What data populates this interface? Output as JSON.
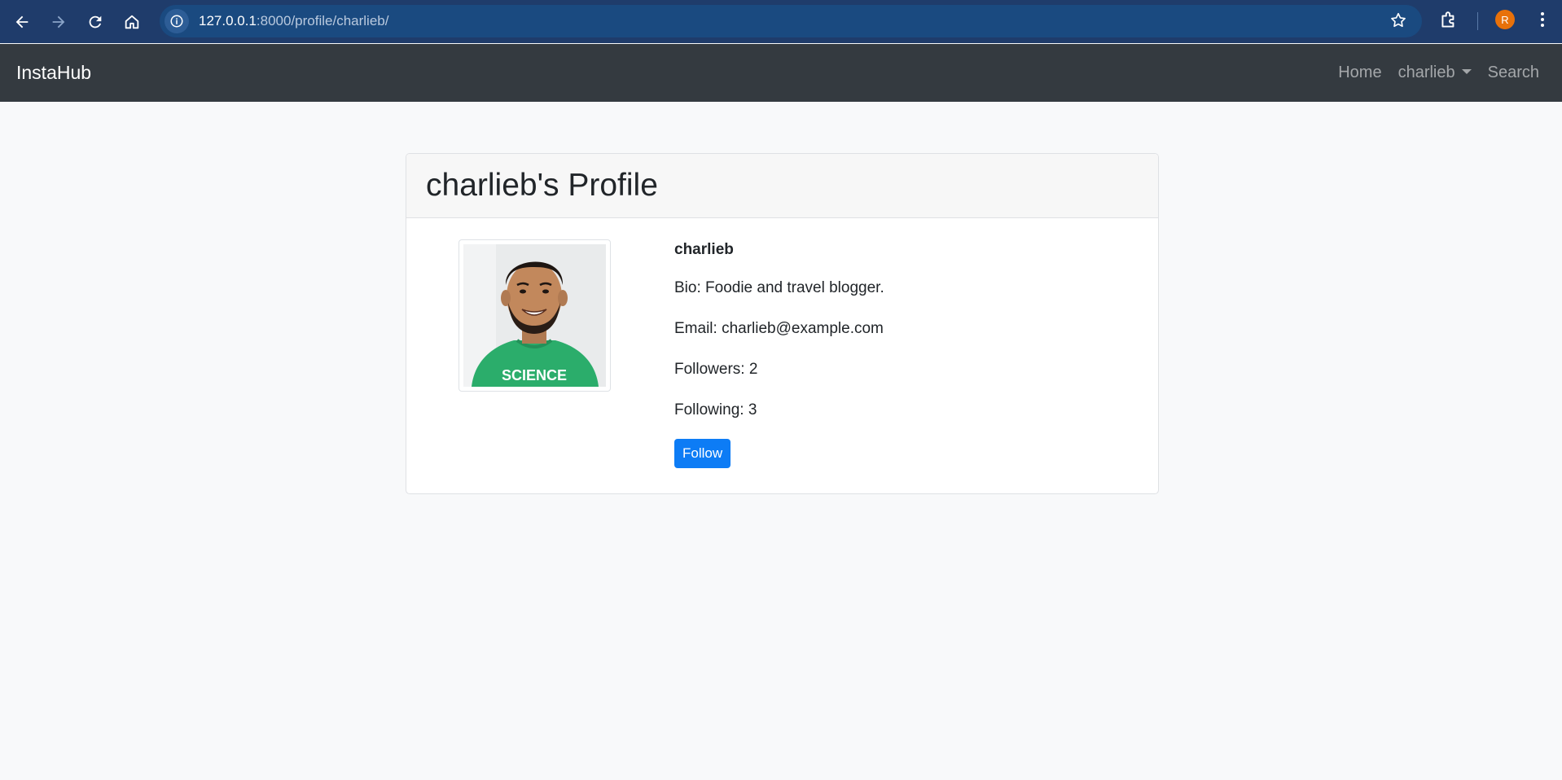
{
  "browser": {
    "url_host": "127.0.0.1",
    "url_path": ":8000/profile/charlieb/",
    "profile_initial": "R"
  },
  "navbar": {
    "brand": "InstaHub",
    "links": {
      "home": "Home",
      "user": "charlieb",
      "search": "Search"
    }
  },
  "profile": {
    "title": "charlieb's Profile",
    "username": "charlieb",
    "bio": "Bio: Foodie and travel blogger.",
    "email": "Email: charlieb@example.com",
    "followers": "Followers: 2",
    "following": "Following: 3",
    "follow_button": "Follow",
    "shirt_text": "SCIENCE"
  },
  "colors": {
    "navbar": "#343a40",
    "primary_button": "#0d7cf5",
    "browser_frame": "#1f3c6b"
  }
}
